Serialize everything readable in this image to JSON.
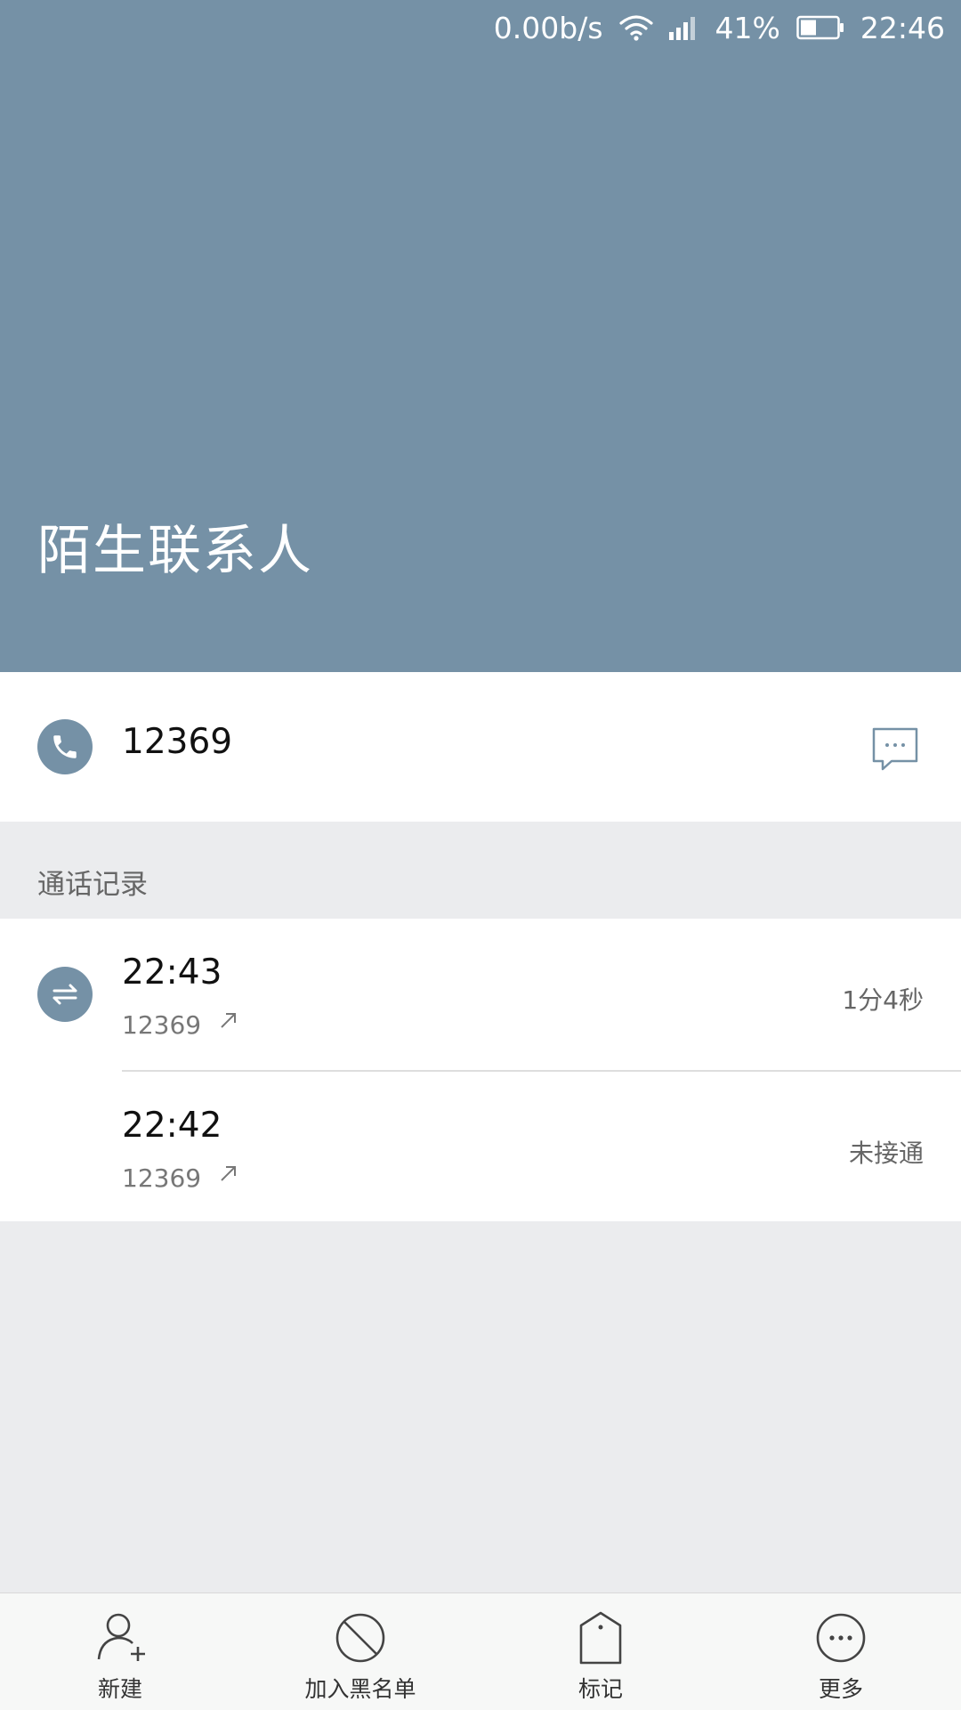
{
  "status_bar": {
    "net_speed": "0.00b/s",
    "battery": "41%",
    "time": "22:46"
  },
  "contact": {
    "title": "陌生联系人",
    "number": "12369"
  },
  "call_log": {
    "section_label": "通话记录",
    "entries": [
      {
        "time": "22:43",
        "number": "12369",
        "info": "1分4秒"
      },
      {
        "time": "22:42",
        "number": "12369",
        "info": "未接通"
      }
    ]
  },
  "bottom_nav": {
    "items": [
      {
        "label": "新建"
      },
      {
        "label": "加入黑名单"
      },
      {
        "label": "标记"
      },
      {
        "label": "更多"
      }
    ]
  },
  "colors": {
    "header_bg": "#7591a6",
    "page_bg": "#ebecee"
  }
}
